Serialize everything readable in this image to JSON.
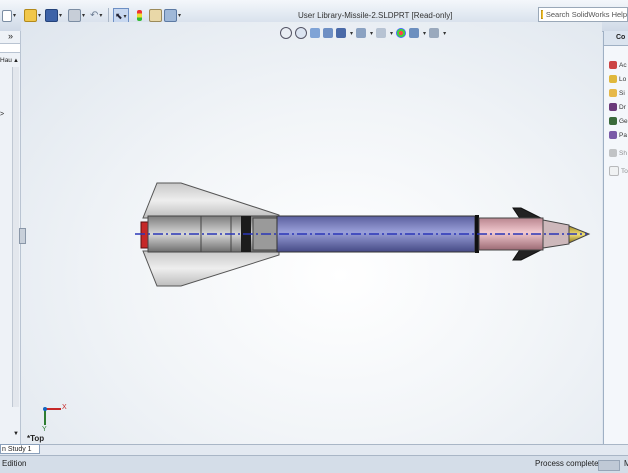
{
  "window": {
    "title": "User Library-Missile-2.SLDPRT [Read-only]"
  },
  "search": {
    "placeholder": "Search SolidWorks Help"
  },
  "left_panel": {
    "partial_label": "Hau",
    "collapse_label": "»"
  },
  "task_pane": {
    "partial_title": "Co",
    "items": [
      {
        "partial": "Ac",
        "icon": "add-in-icon"
      },
      {
        "partial": "Lo",
        "icon": "folder-icon"
      },
      {
        "partial": "Si",
        "icon": "document-icon"
      },
      {
        "partial": "Dr",
        "icon": "drawing-icon"
      },
      {
        "partial": "Ge",
        "icon": "geometry-icon"
      },
      {
        "partial": "Pa",
        "icon": "palette-icon"
      },
      {
        "partial": "Sh",
        "icon": "sheet-icon"
      },
      {
        "partial": "To",
        "icon": "tool-icon"
      }
    ]
  },
  "viewport": {
    "view_label": "*Top",
    "axis_x": "X",
    "axis_y": "Y"
  },
  "tabs": {
    "active_partial": "n Study 1"
  },
  "status": {
    "left": "Edition",
    "center": "Process complete",
    "right": "M"
  }
}
